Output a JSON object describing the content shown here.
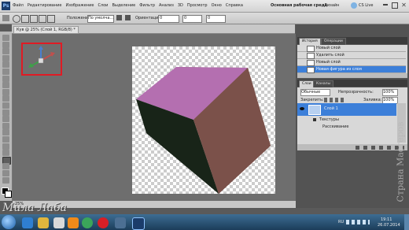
{
  "menu": {
    "logo": "Ps",
    "items": [
      "Файл",
      "Редактирование",
      "Изображение",
      "Слои",
      "Выделение",
      "Фильтр",
      "Анализ",
      "3D",
      "Просмотр",
      "Окно",
      "Справка"
    ],
    "zoom": "25%",
    "workspace": "Основная рабочая среда",
    "design": "Дизайн",
    "cslive": "CS Live"
  },
  "options": {
    "position_label": "Положение:",
    "position_value": "По умолча...",
    "orientation_label": "Ориентация:",
    "orientation_value": "0",
    "field2": "0",
    "field3": "0"
  },
  "document": {
    "tab_title": "Кув @ 25% (Слой 1, RGB/8) *",
    "status": "25%"
  },
  "history": {
    "tabs": [
      "История",
      "Операции"
    ],
    "rows": [
      "Новый слой",
      "Удалить слой",
      "Новый слой",
      "Новая фигура из слоя"
    ]
  },
  "layers": {
    "tabs": [
      "Слои",
      "Каналы"
    ],
    "blend_mode": "Обычные",
    "opacity_label": "Непрозрачность:",
    "opacity_value": "100%",
    "lock_label": "Закрепить:",
    "fill_label": "Заливка:",
    "fill_value": "100%",
    "layer_name": "Слой 1",
    "sub_textures": "Текстуры",
    "sub_diffuse": "Рассеивание"
  },
  "watermark": {
    "text": "Страна Мастеров"
  },
  "signature": {
    "text": "Мила Лаба"
  },
  "taskbar": {
    "lang": "RU",
    "time": "19:11",
    "date": "26.07.2014"
  },
  "colors": {
    "cube_top": "#b46fb0",
    "cube_right": "#7b514a",
    "cube_left": "#182418",
    "highlight_box": "#e01b24",
    "selection_blue": "#3c7fd9"
  }
}
